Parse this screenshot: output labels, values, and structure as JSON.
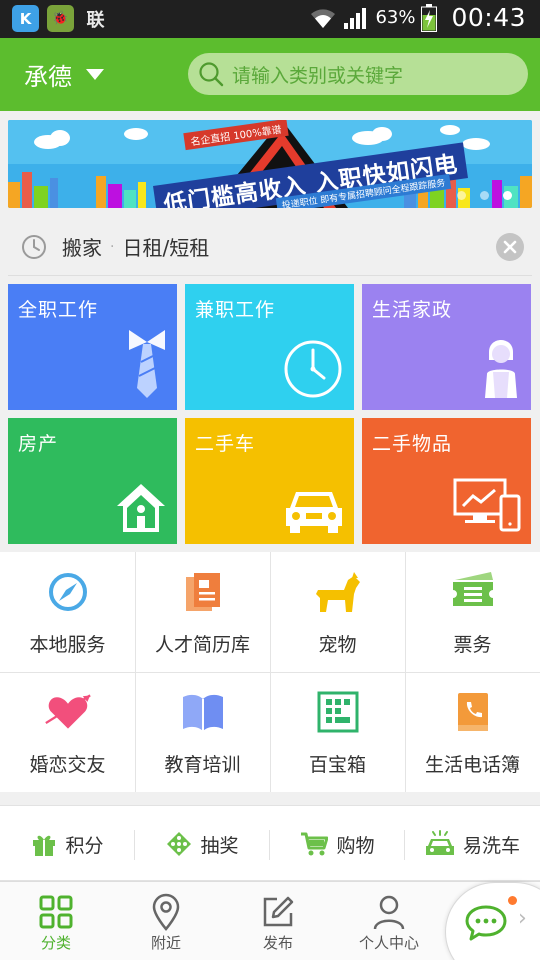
{
  "status_bar": {
    "app_icons": [
      "K",
      "🐞",
      "联"
    ],
    "battery_percent": "63%",
    "time": "00:43"
  },
  "header": {
    "city": "承德",
    "search_placeholder": "请输入类别或关键字"
  },
  "banner": {
    "tag_small": "名企直招 100%靠谱",
    "headline": "低门槛高收入 入职快如闪电",
    "sub": "投递职位 即有专属招聘顾问全程跟踪服务",
    "dot_count": 3,
    "active_dot": 3
  },
  "history": {
    "item1": "搬家",
    "separator": "·",
    "item2": "日租/短租"
  },
  "tiles": [
    {
      "label": "全职工作",
      "color": "#4a7ef5",
      "icon": "tie-icon"
    },
    {
      "label": "兼职工作",
      "color": "#2fd0ef",
      "icon": "clock-icon"
    },
    {
      "label": "生活家政",
      "color": "#9b82f0",
      "icon": "housekeeper-icon"
    },
    {
      "label": "房产",
      "color": "#2fbb5d",
      "icon": "house-icon"
    },
    {
      "label": "二手车",
      "color": "#f5c000",
      "icon": "car-icon"
    },
    {
      "label": "二手物品",
      "color": "#f0642f",
      "icon": "devices-icon"
    }
  ],
  "services": [
    {
      "label": "本地服务",
      "icon": "compass-icon"
    },
    {
      "label": "人才简历库",
      "icon": "resume-icon"
    },
    {
      "label": "宠物",
      "icon": "dog-icon"
    },
    {
      "label": "票务",
      "icon": "ticket-icon"
    },
    {
      "label": "婚恋交友",
      "icon": "heart-arrow-icon"
    },
    {
      "label": "教育培训",
      "icon": "book-icon"
    },
    {
      "label": "百宝箱",
      "icon": "toolbox-icon"
    },
    {
      "label": "生活电话簿",
      "icon": "phonebook-icon"
    }
  ],
  "features": [
    {
      "label": "积分",
      "icon": "gift-icon"
    },
    {
      "label": "抽奖",
      "icon": "lottery-icon"
    },
    {
      "label": "购物",
      "icon": "cart-icon"
    },
    {
      "label": "易洗车",
      "icon": "carwash-icon"
    }
  ],
  "bottom_nav": [
    {
      "label": "分类",
      "icon": "grid-icon",
      "active": true
    },
    {
      "label": "附近",
      "icon": "location-pin-icon",
      "active": false
    },
    {
      "label": "发布",
      "icon": "edit-icon",
      "active": false
    },
    {
      "label": "个人中心",
      "icon": "person-icon",
      "active": false
    }
  ],
  "colors": {
    "brand_green": "#5cbd2e",
    "active_nav": "#4fb22e"
  }
}
